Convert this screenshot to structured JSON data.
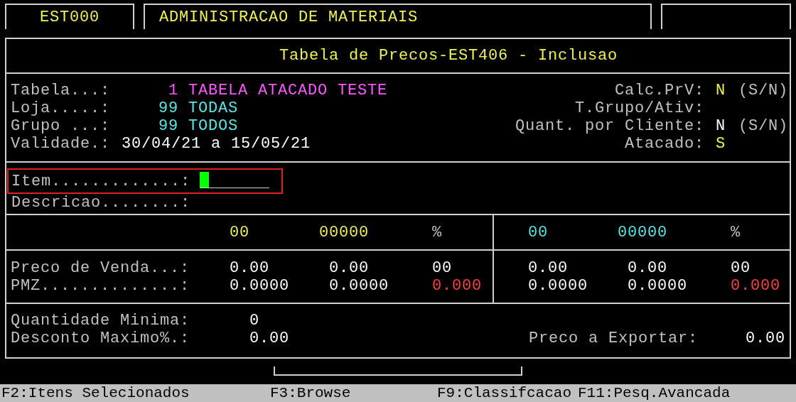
{
  "header_tabs": [
    {
      "text": "EST000"
    },
    {
      "text": "ADMINISTRACAO DE MATERIAIS"
    }
  ],
  "screen_title": "Tabela de Precos-EST406 - Inclusao",
  "header_left": [
    {
      "label": "Tabela...:",
      "code": "1",
      "value": "TABELA ATACADO TESTE",
      "color": "#ff55ff"
    },
    {
      "label": "Loja.....:",
      "code": "99",
      "value": "TODAS",
      "color": "#55e8e8"
    },
    {
      "label": "Grupo ...:",
      "code": "99",
      "value": "TODOS",
      "color": "#55e8e8"
    },
    {
      "label": "Validade.:",
      "value": "30/04/21 a 15/05/21",
      "color": "#ffffff"
    }
  ],
  "header_right": [
    {
      "label": "Calc.PrV:",
      "value": "N",
      "hint": "(S/N)",
      "color": "#f0f050"
    },
    {
      "label": "T.Grupo/Ativ:"
    },
    {
      "label": "Quant. por Cliente:",
      "value": "N",
      "hint": "(S/N)",
      "color": "#ffffff"
    },
    {
      "label": "Atacado:",
      "value": "S",
      "color": "#f0f050"
    }
  ],
  "item": {
    "label": "Item.............:",
    "focused": true,
    "highlighted": true
  },
  "description": {
    "label": "Descricao........:"
  },
  "price_table": {
    "row_labels": [
      "Preco de Venda...:",
      "PMZ..............:"
    ],
    "panels": [
      {
        "color": "#f0f050",
        "columns": [
          "00",
          "00000",
          "%"
        ],
        "rows": [
          [
            {
              "text": "0.00"
            },
            {
              "text": "0.00"
            },
            {
              "text": "00"
            }
          ],
          [
            {
              "text": "0.0000"
            },
            {
              "text": "0.0000"
            },
            {
              "text": "0.000",
              "color": "#ff4040"
            }
          ]
        ]
      },
      {
        "color": "#55e8e8",
        "columns": [
          "00",
          "00000",
          "%"
        ],
        "rows": [
          [
            {
              "text": "0.00"
            },
            {
              "text": "0.00"
            },
            {
              "text": "00"
            }
          ],
          [
            {
              "text": "0.0000"
            },
            {
              "text": "0.0000"
            },
            {
              "text": "0.000",
              "color": "#ff4040"
            }
          ]
        ]
      }
    ]
  },
  "limits": [
    {
      "label": "Quantidade Minima:",
      "value": "0"
    },
    {
      "label": "Desconto Maximo%.:",
      "value": "0.00"
    }
  ],
  "export_price": {
    "label": "Preco a Exportar:",
    "value": "0.00"
  },
  "function_keys": [
    "F2:Itens Selecionados",
    "F3:Browse",
    "F9:Classifcacao",
    "F11:Pesq.Avancada"
  ]
}
